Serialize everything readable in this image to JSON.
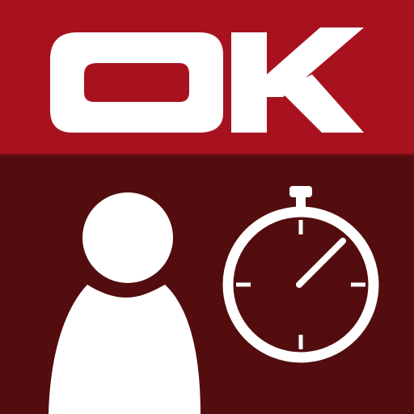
{
  "logo": {
    "text": "OK"
  },
  "icons": {
    "person": "person-icon",
    "stopwatch": "stopwatch-icon"
  },
  "colors": {
    "brand_red": "#a8121f",
    "dark_red": "#530d0f",
    "foreground": "#ffffff"
  }
}
